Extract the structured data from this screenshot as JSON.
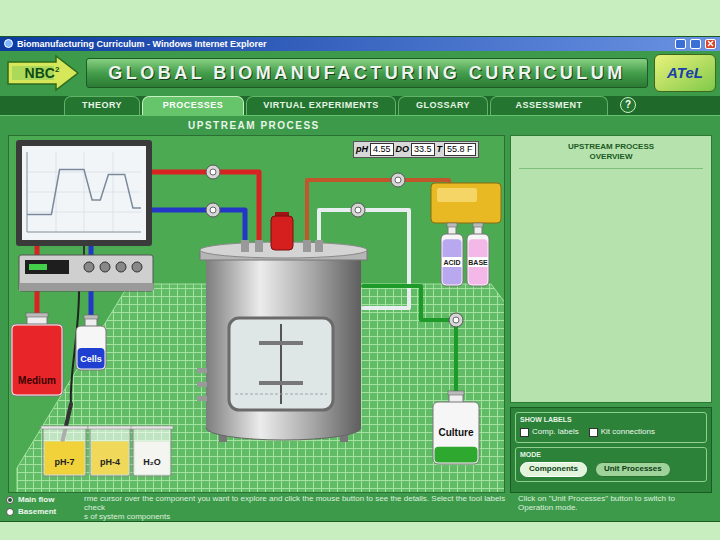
{
  "window": {
    "title": "Biomanufacturing Curriculum - Windows Internet Explorer"
  },
  "header": {
    "logo_left": "NBC",
    "logo_left_sup": "2",
    "banner": "GLOBAL BIOMANUFACTURING CURRICULUM",
    "logo_right": "ATeL"
  },
  "tabs": [
    {
      "label": "THEORY",
      "selected": false
    },
    {
      "label": "PROCESSES",
      "selected": true
    },
    {
      "label": "VIRTUAL EXPERIMENTS",
      "selected": false
    },
    {
      "label": "GLOSSARY",
      "selected": false
    },
    {
      "label": "ASSESSMENT",
      "selected": false
    }
  ],
  "help": "?",
  "page_title": "UPSTREAM PROCESS",
  "readout": [
    {
      "label": "pH",
      "value": "4.55"
    },
    {
      "label": "DO",
      "value": "33.5"
    },
    {
      "label": "T",
      "value": "55.8 F"
    }
  ],
  "monitor": {
    "series": [
      [
        22,
        22,
        22,
        22,
        78,
        78,
        78,
        78,
        40,
        40,
        72,
        72,
        72,
        30,
        30
      ]
    ]
  },
  "components": [
    {
      "label": "Medium",
      "kind": "bottle",
      "color": "#e8262a"
    },
    {
      "label": "Cells",
      "kind": "bottle",
      "color": "#1f3fd0"
    },
    {
      "label": "pH-7",
      "kind": "beaker",
      "color": "#f2d23a"
    },
    {
      "label": "pH-4",
      "kind": "beaker",
      "color": "#f0d85a"
    },
    {
      "label": "H₂O",
      "kind": "beaker",
      "color": "#f4f4f0"
    },
    {
      "label": "ACID",
      "kind": "reagent",
      "color": "#b8a8f0"
    },
    {
      "label": "BASE",
      "kind": "reagent",
      "color": "#f4b8e8"
    },
    {
      "label": "Culture",
      "kind": "bottle",
      "color": "#2ea82e"
    }
  ],
  "overview": {
    "title": "UPSTREAM PROCESS OVERVIEW"
  },
  "show_labels": {
    "title": "SHOW LABELS",
    "options": [
      {
        "label": "Comp. labels",
        "checked": false
      },
      {
        "label": "Kit connections",
        "checked": false
      }
    ]
  },
  "mode": {
    "title": "MODE",
    "buttons": [
      {
        "label": "Components",
        "selected": true
      },
      {
        "label": "Unit Processes",
        "selected": false
      }
    ]
  },
  "legend": [
    {
      "label": "Main flow",
      "selected": true
    },
    {
      "label": "Basement",
      "selected": false
    }
  ],
  "instructions": [
    "rme cursor over the component you want to explore and click the mouse button to see the details. Select the tool labels check",
    "s of system components"
  ],
  "hint": [
    "Click on \"Unit Processes\" button to switch to",
    "Operation mode."
  ]
}
